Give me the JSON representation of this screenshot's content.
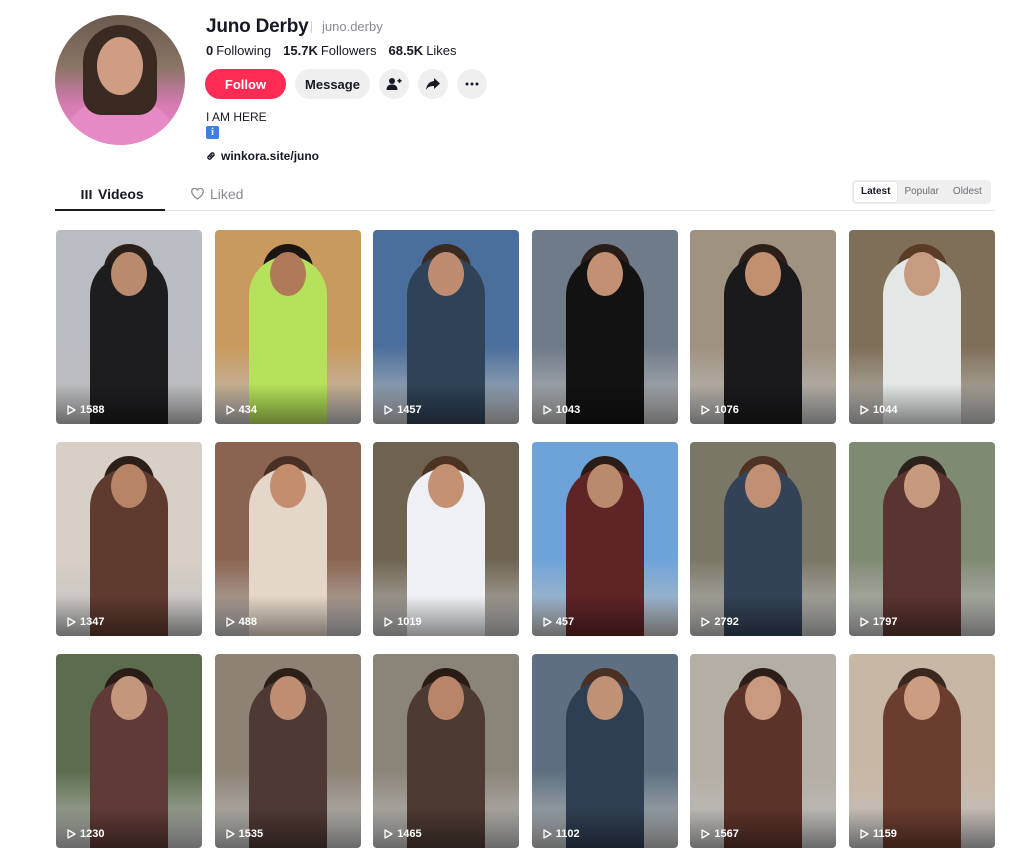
{
  "profile": {
    "name": "Juno Derby",
    "username": "juno.derby",
    "following_count": "0",
    "following_label": "Following",
    "followers_count": "15.7K",
    "followers_label": "Followers",
    "likes_count": "68.5K",
    "likes_label": "Likes",
    "bio": "I AM HERE",
    "bio_badge": "i",
    "link": "winkora.site/juno"
  },
  "actions": {
    "follow_label": "Follow",
    "message_label": "Message",
    "add_friend_icon": "person-add-icon",
    "share_icon": "share-arrow-icon",
    "more_icon": "more-dots-icon"
  },
  "tabs": {
    "videos_label": "Videos",
    "liked_label": "Liked"
  },
  "sort": [
    "Latest",
    "Popular",
    "Oldest"
  ],
  "sort_selected": "Latest",
  "videos": [
    {
      "views": "1588",
      "bg": "#b9bcc2",
      "top": "#1d1d1f",
      "skin": "#b98a6d",
      "hair": "#2b1f1a"
    },
    {
      "views": "434",
      "bg": "#c99a5e",
      "top": "#b6e15a",
      "skin": "#b07a5a",
      "hair": "#1b1412"
    },
    {
      "views": "1457",
      "bg": "#4b6f9c",
      "top": "#2f4257",
      "skin": "#c08c70",
      "hair": "#3a2a22"
    },
    {
      "views": "1043",
      "bg": "#6f7b89",
      "top": "#121212",
      "skin": "#c49074",
      "hair": "#2a1d18"
    },
    {
      "views": "1076",
      "bg": "#9f9280",
      "top": "#1a1a1c",
      "skin": "#c2906f",
      "hair": "#2c1f19"
    },
    {
      "views": "1044",
      "bg": "#7f6f58",
      "top": "#e3e8e6",
      "skin": "#c79b80",
      "hair": "#5a3b26"
    },
    {
      "views": "1347",
      "bg": "#d8d0c6",
      "top": "#5e3a2f",
      "skin": "#b88466",
      "hair": "#2c1f18"
    },
    {
      "views": "488",
      "bg": "#8a6450",
      "top": "#e4d6c8",
      "skin": "#c48e6e",
      "hair": "#4a3024"
    },
    {
      "views": "1019",
      "bg": "#6e6350",
      "top": "#eef0f3",
      "skin": "#c49172",
      "hair": "#4d3322"
    },
    {
      "views": "457",
      "bg": "#6ea3d9",
      "top": "#5e2426",
      "skin": "#b98a6c",
      "hair": "#2a1c16"
    },
    {
      "views": "2792",
      "bg": "#7b7766",
      "top": "#334256",
      "skin": "#c19074",
      "hair": "#4e3324"
    },
    {
      "views": "1797",
      "bg": "#7f8a73",
      "top": "#5a3430",
      "skin": "#c79a80",
      "hair": "#2c211b"
    },
    {
      "views": "1230",
      "bg": "#5b6d4c",
      "top": "#5f3a36",
      "skin": "#c4967c",
      "hair": "#2a1d17"
    },
    {
      "views": "1535",
      "bg": "#8d8274",
      "top": "#4e3934",
      "skin": "#bf8e72",
      "hair": "#2d1f19"
    },
    {
      "views": "1465",
      "bg": "#8b8478",
      "top": "#4d3a32",
      "skin": "#b98568",
      "hair": "#2a1c15"
    },
    {
      "views": "1102",
      "bg": "#5d6f80",
      "top": "#2f3f52",
      "skin": "#c19176",
      "hair": "#4a3123"
    },
    {
      "views": "1567",
      "bg": "#b4aea4",
      "top": "#5b3329",
      "skin": "#c99a7f",
      "hair": "#2c1f19"
    },
    {
      "views": "1159",
      "bg": "#c9b7a5",
      "top": "#6a3d2e",
      "skin": "#cc9d82",
      "hair": "#3a281f"
    }
  ],
  "colors": {
    "accent": "#fe2c55",
    "text": "#161823",
    "muted": "#8a8b91",
    "button_bg": "#efeff0"
  }
}
